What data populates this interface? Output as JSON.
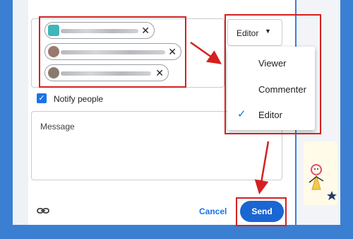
{
  "recipients": [
    {
      "label": "",
      "avatar_color": "#3fb6b8"
    },
    {
      "label": "",
      "avatar_color": "#9a7a6d"
    },
    {
      "label": "",
      "avatar_color": "#8a7a6e"
    }
  ],
  "role_button": {
    "label": "Editor",
    "caret": "▼"
  },
  "role_menu": {
    "items": [
      {
        "label": "Viewer",
        "selected": false
      },
      {
        "label": "Commenter",
        "selected": false
      },
      {
        "label": "Editor",
        "selected": true
      }
    ]
  },
  "notify": {
    "label": "Notify people",
    "checked": true
  },
  "message": {
    "placeholder": "Message"
  },
  "footer": {
    "cancel_label": "Cancel",
    "send_label": "Send",
    "link_icon": "link-icon"
  },
  "colors": {
    "accent": "#1a73e8",
    "annotation": "#d62020",
    "background": "#3b7fd3"
  }
}
